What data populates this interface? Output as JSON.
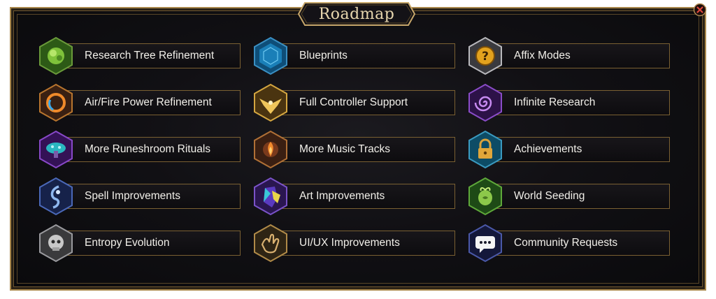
{
  "window": {
    "title": "Roadmap"
  },
  "colors": {
    "gold": "#a8874c",
    "text": "#f1efe9"
  },
  "roadmap": [
    {
      "label": "Research Tree Refinement",
      "icon": "green-tree-icon"
    },
    {
      "label": "Blueprints",
      "icon": "blue-blueprint-icon"
    },
    {
      "label": "Affix Modes",
      "icon": "gold-question-icon"
    },
    {
      "label": "Air/Fire Power Refinement",
      "icon": "fire-ring-icon"
    },
    {
      "label": "Full Controller Support",
      "icon": "gold-eagle-icon"
    },
    {
      "label": "Infinite Research",
      "icon": "purple-spiral-icon"
    },
    {
      "label": "More Runeshroom Rituals",
      "icon": "purple-mushroom-icon"
    },
    {
      "label": "More Music Tracks",
      "icon": "flame-sun-icon"
    },
    {
      "label": "Achievements",
      "icon": "padlock-icon"
    },
    {
      "label": "Spell Improvements",
      "icon": "blue-swirl-icon"
    },
    {
      "label": "Art Improvements",
      "icon": "crystal-icon"
    },
    {
      "label": "World Seeding",
      "icon": "green-seed-icon"
    },
    {
      "label": "Entropy Evolution",
      "icon": "stone-skull-icon"
    },
    {
      "label": "UI/UX Improvements",
      "icon": "hand-icon"
    },
    {
      "label": "Community Requests",
      "icon": "chat-bubble-icon"
    }
  ]
}
